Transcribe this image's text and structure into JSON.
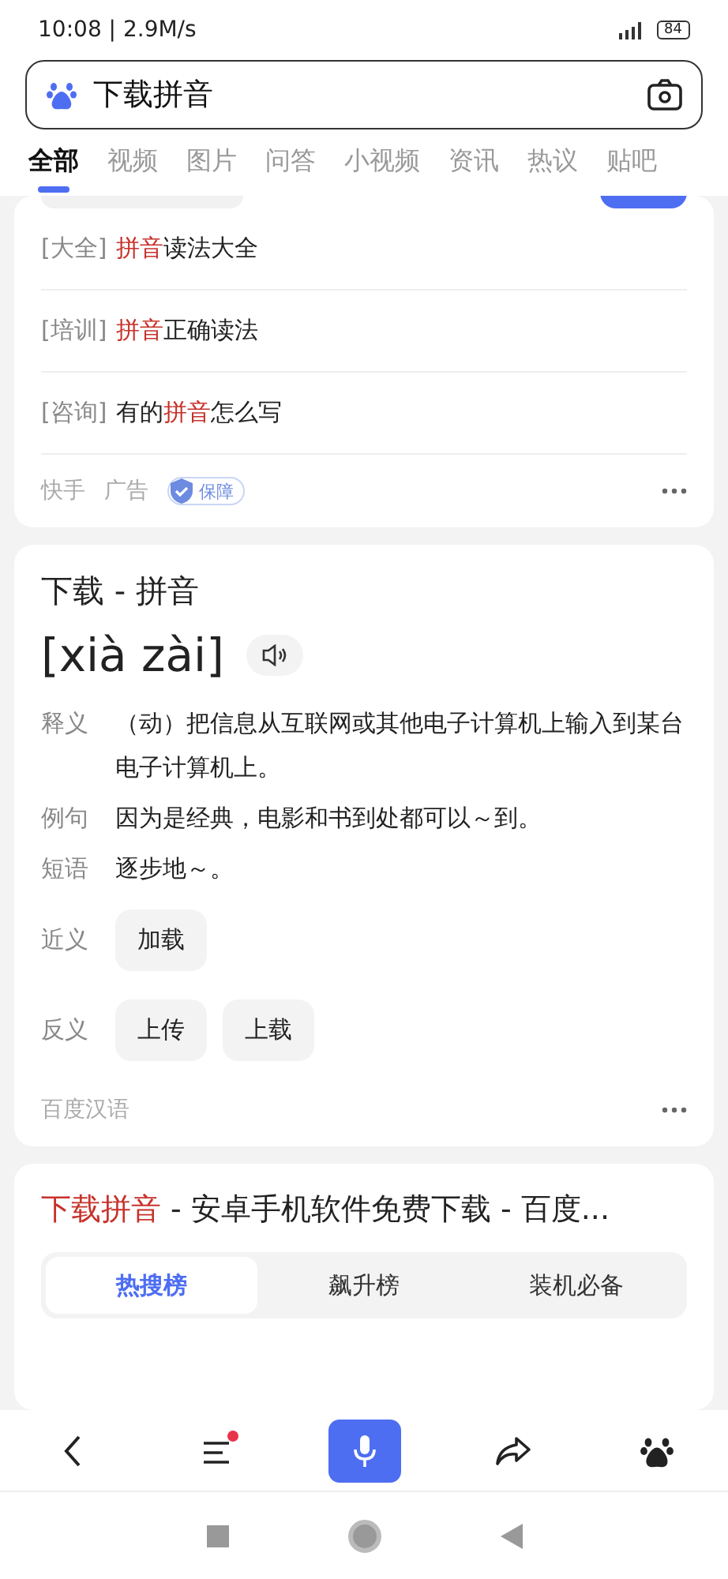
{
  "status_bar": {
    "time": "10:08 | 2.9M/s",
    "battery": "84"
  },
  "search": {
    "value": "下载拼音"
  },
  "tabs": [
    {
      "label": "全部",
      "selected": true
    },
    {
      "label": "视频",
      "selected": false
    },
    {
      "label": "图片",
      "selected": false
    },
    {
      "label": "问答",
      "selected": false
    },
    {
      "label": "小视频",
      "selected": false
    },
    {
      "label": "资讯",
      "selected": false
    },
    {
      "label": "热议",
      "selected": false
    },
    {
      "label": "贴吧",
      "selected": false
    }
  ],
  "ad_card": {
    "links": [
      {
        "tag": "[大全]",
        "parts": [
          {
            "text": "拼音",
            "highlight": true
          },
          {
            "text": "读法大全",
            "highlight": false
          }
        ]
      },
      {
        "tag": "[培训]",
        "parts": [
          {
            "text": "拼音",
            "highlight": true
          },
          {
            "text": "正确读法",
            "highlight": false
          }
        ]
      },
      {
        "tag": "[咨询]",
        "parts": [
          {
            "text": "有的",
            "highlight": false
          },
          {
            "text": "拼音",
            "highlight": true
          },
          {
            "text": "怎么写",
            "highlight": false
          }
        ]
      }
    ],
    "source": "快手",
    "ad_label": "广告",
    "badge": "保障"
  },
  "dict_card": {
    "title": "下载 - 拼音",
    "pinyin": "[xià zài]",
    "rows": [
      {
        "label": "释义",
        "text": "（动）把信息从互联网或其他电子计算机上输入到某台电子计算机上。"
      },
      {
        "label": "例句",
        "text": "因为是经典，电影和书到处都可以～到。"
      },
      {
        "label": "短语",
        "text": "逐步地～。"
      }
    ],
    "word_groups": [
      {
        "label": "近义",
        "words": [
          "加载"
        ]
      },
      {
        "label": "反义",
        "words": [
          "上传",
          "上载"
        ]
      }
    ],
    "source": "百度汉语"
  },
  "result_card": {
    "title_parts": [
      {
        "text": "下载拼音",
        "highlight": true
      },
      {
        "text": " - 安卓手机软件免费下载 - 百度...",
        "highlight": false
      }
    ],
    "tabs": [
      {
        "label": "热搜榜",
        "selected": true
      },
      {
        "label": "飙升榜",
        "selected": false
      },
      {
        "label": "装机必备",
        "selected": false
      }
    ]
  },
  "bottom_nav": {
    "menu_badge": true
  }
}
